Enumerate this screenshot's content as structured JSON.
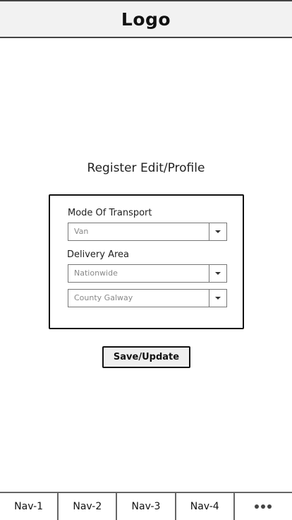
{
  "header": {
    "logo": "Logo"
  },
  "page": {
    "title": "Register Edit/Profile"
  },
  "form": {
    "mode_of_transport": {
      "label": "Mode Of Transport",
      "value": "Van"
    },
    "delivery_area": {
      "label": "Delivery Area",
      "region_value": "Nationwide",
      "county_value": "County Galway"
    }
  },
  "actions": {
    "save_label": "Save/Update"
  },
  "nav": {
    "items": [
      {
        "label": "Nav-1"
      },
      {
        "label": "Nav-2"
      },
      {
        "label": "Nav-3"
      },
      {
        "label": "Nav-4"
      }
    ],
    "more_icon": "more-dots-icon"
  }
}
